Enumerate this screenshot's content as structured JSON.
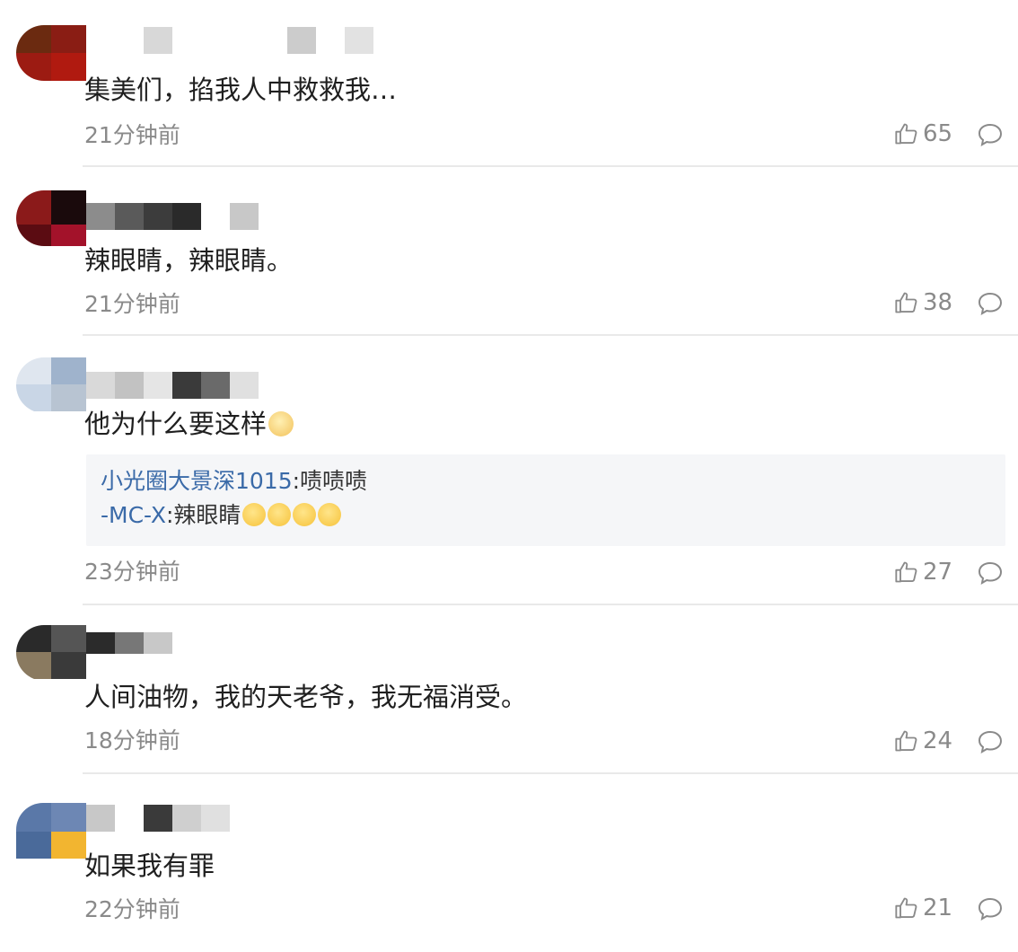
{
  "comments": [
    {
      "text": "集美们，掐我人中救救我…",
      "time": "21分钟前",
      "likes": "65",
      "avatar_colors": [
        "#6b2a10",
        "#8a1d14",
        "#9c1b12",
        "#5a1a0e"
      ],
      "name_colors": [
        "#d8d8d8",
        "#cccccc",
        "#d0d0d0",
        "#e2e2e2"
      ]
    },
    {
      "text": "辣眼睛，辣眼睛。",
      "time": "21分钟前",
      "likes": "38",
      "avatar_colors": [
        "#8b1a1a",
        "#5b0c12",
        "#a3122a",
        "#6a0f18"
      ],
      "name_colors": [
        "#2a2a2a",
        "#8c8c8c",
        "#5a5a5a",
        "#3c3c3c",
        "#c8c8c8"
      ]
    },
    {
      "text": "他为什么要这样",
      "time": "23分钟前",
      "likes": "27",
      "avatar_colors": [
        "#c9d6e6",
        "#9fb3cc",
        "#dfe6ef",
        "#b8c4d2"
      ],
      "name_colors": [
        "#d9d9d9",
        "#c2c2c2",
        "#e5e5e5",
        "#3a3a3a",
        "#6a6a6a",
        "#e0e0e0"
      ],
      "quotes": [
        {
          "user": "小光圈大景深1015",
          "content": ":啧啧啧"
        },
        {
          "user": "-MC-X",
          "content": ":辣眼睛"
        }
      ]
    },
    {
      "text": "人间油物，我的天老爷，我无福消受。",
      "time": "18分钟前",
      "likes": "24",
      "avatar_colors": [
        "#2a2a2a",
        "#555555",
        "#8a7a60",
        "#3a3a3a"
      ],
      "name_colors": [
        "#2b2b2b",
        "#777777",
        "#c8c8c8"
      ]
    },
    {
      "text": "如果我有罪",
      "time": "22分钟前",
      "likes": "21",
      "avatar_colors": [
        "#5a78a8",
        "#4a6a9a",
        "#f2b530",
        "#6d87b4"
      ],
      "name_colors": [
        "#c8c8c8",
        "#3a3a3a",
        "#cfcfcf",
        "#e0e0e0"
      ]
    }
  ]
}
